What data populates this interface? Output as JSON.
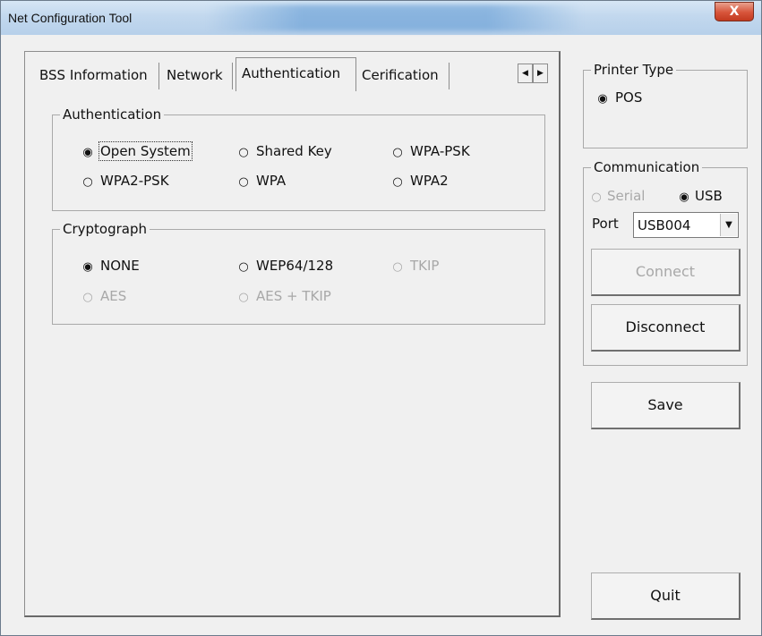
{
  "window": {
    "title": "Net Configuration Tool",
    "close_glyph": "X"
  },
  "tabs": [
    {
      "label": "BSS Information"
    },
    {
      "label": "Network"
    },
    {
      "label": "Authentication"
    },
    {
      "label": "Cerification"
    }
  ],
  "tab_arrows": {
    "left": "◀",
    "right": "▶"
  },
  "authentication": {
    "legend": "Authentication",
    "options": [
      {
        "label": "Open System",
        "checked": true
      },
      {
        "label": "Shared Key"
      },
      {
        "label": "WPA-PSK"
      },
      {
        "label": "WPA2-PSK"
      },
      {
        "label": "WPA"
      },
      {
        "label": "WPA2"
      }
    ]
  },
  "cryptograph": {
    "legend": "Cryptograph",
    "options": [
      {
        "label": "NONE",
        "checked": true
      },
      {
        "label": "WEP64/128"
      },
      {
        "label": "TKIP",
        "disabled": true
      },
      {
        "label": "AES",
        "disabled": true
      },
      {
        "label": "AES + TKIP",
        "disabled": true
      }
    ]
  },
  "printer_type": {
    "legend": "Printer Type",
    "option": "POS"
  },
  "communication": {
    "legend": "Communication",
    "serial": "Serial",
    "usb": "USB",
    "port_label": "Port",
    "port_value": "USB004"
  },
  "buttons": {
    "connect": "Connect",
    "disconnect": "Disconnect",
    "save": "Save",
    "quit": "Quit"
  },
  "glyphs": {
    "radio_on": "◉",
    "radio_off": "○",
    "dropdown": "▼"
  }
}
